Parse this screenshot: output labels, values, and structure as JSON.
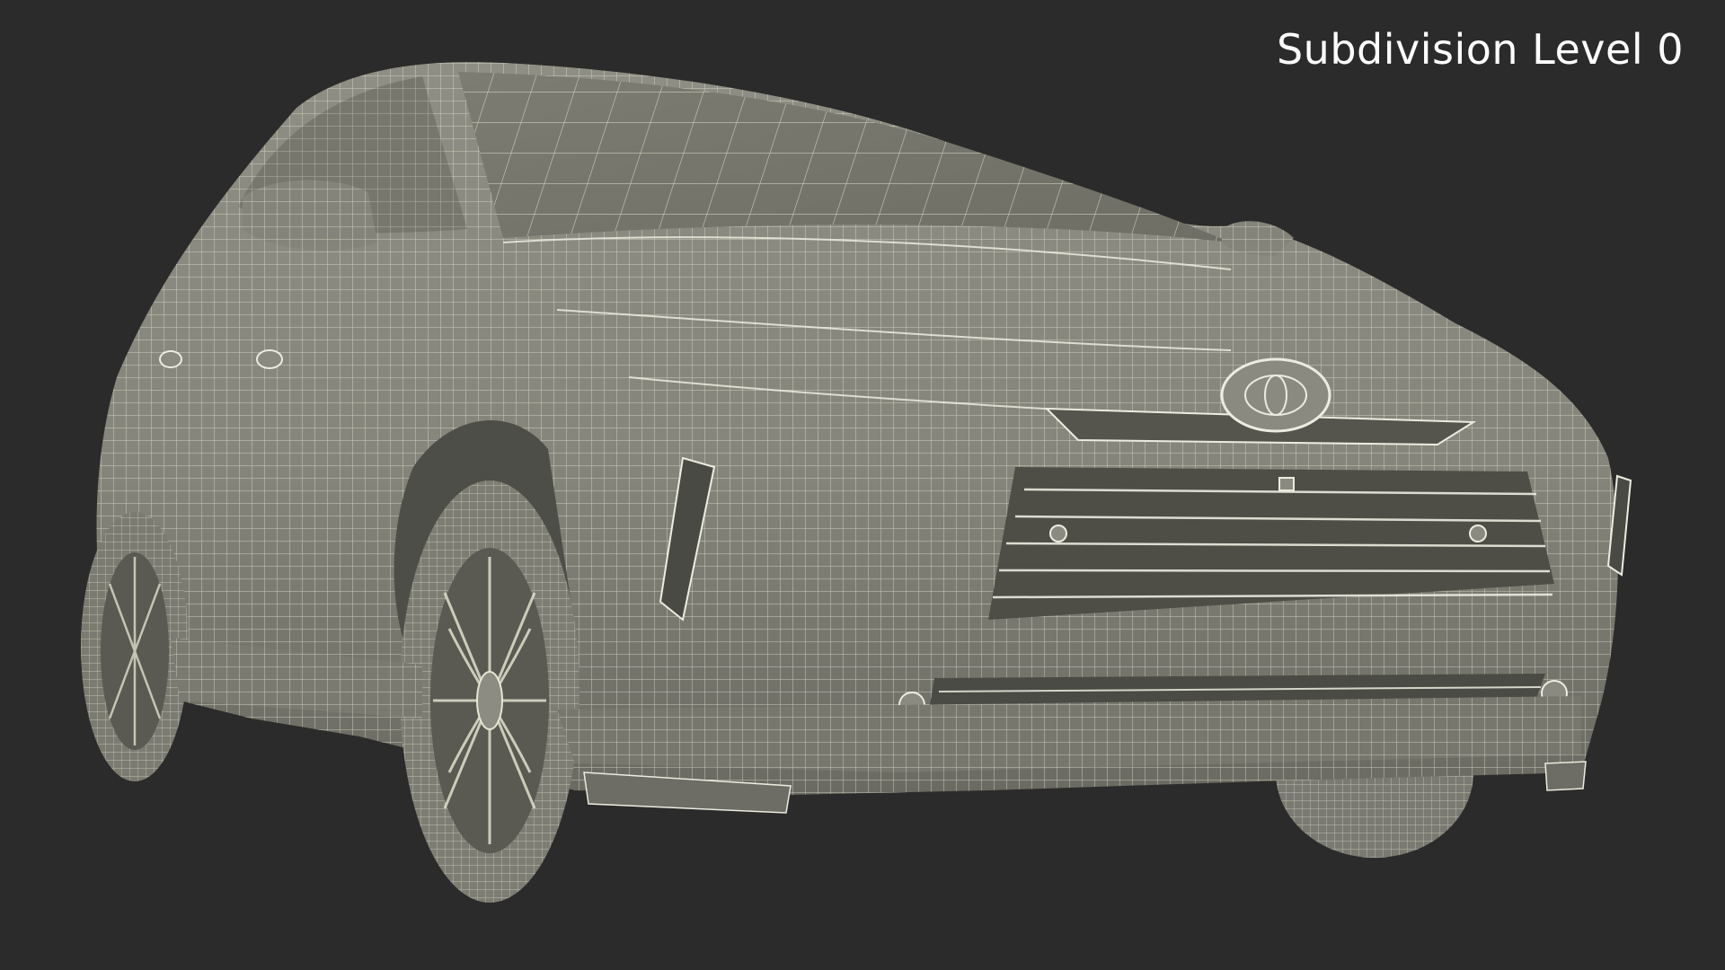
{
  "viewport": {
    "subdivision_label": "Subdivision Level 0",
    "background_color": "#2b2b2b",
    "label_color": "#ffffff"
  },
  "model": {
    "render_style": "wireframe-on-shaded",
    "surface_color": "#8c8c82",
    "wire_color": "#e6e6d2"
  }
}
